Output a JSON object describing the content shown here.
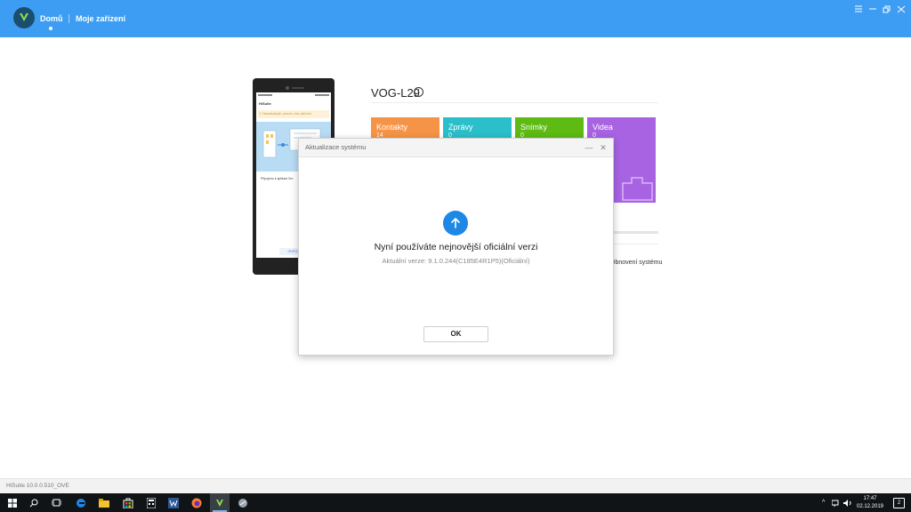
{
  "header": {
    "nav_home": "Domů",
    "nav_devices": "Moje zařízení",
    "brand_color": "#3d9df2",
    "window_controls": [
      "menu-icon",
      "minimize-icon",
      "restore-icon",
      "close-icon"
    ]
  },
  "phone_screen": {
    "app_title": "HiSuite",
    "warning": "Neautorizujte, prosím, toto zařízení",
    "connect_text": "Připojeno k aplikaci Sm",
    "button": "ODPOJI"
  },
  "device": {
    "name": "VOG-L29"
  },
  "tiles": [
    {
      "label": "Kontakty",
      "count": "14",
      "color": "#f59446"
    },
    {
      "label": "Zprávy",
      "count": "0",
      "color": "#2bbfca"
    },
    {
      "label": "Snímky",
      "count": "0",
      "color": "#5dbb13"
    },
    {
      "label": "Videa",
      "count": "0",
      "color": "#a863e3"
    }
  ],
  "restore_text": "Obnovení systému",
  "dialog": {
    "title": "Aktualizace systému",
    "minimize": "—",
    "close": "✕",
    "message": "Nyní používáte nejnovější oficiální verzi",
    "version_info": "Aktuální verze: 9.1.0.244(C185E4R1P5)(Oficiální)",
    "ok_label": "OK",
    "icon": "arrow-up-icon",
    "icon_color": "#1e88e5"
  },
  "status_bar": {
    "version": "HiSuite 10.0.0.510_OVE"
  },
  "taskbar": {
    "clock_time": "17:47",
    "clock_date": "02.12.2019",
    "notification_count": "2",
    "apps": [
      "windows-start-icon",
      "search-icon",
      "task-view-icon",
      "edge-icon",
      "file-explorer-icon",
      "store-icon",
      "calculator-icon",
      "word-icon",
      "firefox-icon",
      "hisuite-icon",
      "misc-app-icon"
    ]
  }
}
